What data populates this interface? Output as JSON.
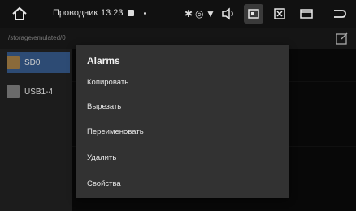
{
  "statusbar": {
    "title": "Проводник",
    "time": "13:23",
    "icons": [
      "home-icon",
      "notification-icon",
      "bluetooth-icon",
      "location-icon",
      "wifi-icon",
      "volume-icon",
      "screenshot-icon",
      "close-box-icon",
      "window-icon",
      "back-icon"
    ]
  },
  "pathbar": {
    "path": "/storage/emulated/0"
  },
  "sidebar": {
    "items": [
      {
        "label": "SD0",
        "selected": true
      },
      {
        "label": "USB1-4",
        "selected": false
      }
    ]
  },
  "dialog": {
    "title": "Alarms",
    "items": [
      {
        "label": "Копировать"
      },
      {
        "label": "Вырезать"
      },
      {
        "label": "Переименовать"
      },
      {
        "label": "Удалить"
      },
      {
        "label": "Свойства"
      }
    ]
  },
  "colors": {
    "accent": "#2d4b74",
    "dialog_bg": "#323232"
  }
}
